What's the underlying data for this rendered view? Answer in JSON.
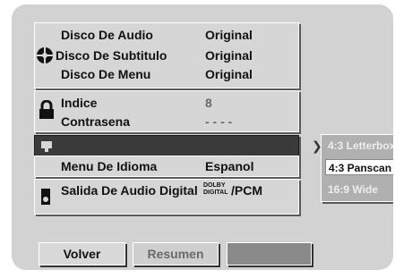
{
  "menu": {
    "disc": {
      "audio_label": "Disco De Audio",
      "audio_value": "Original",
      "subtitle_label": "Disco De Subtitulo",
      "subtitle_value": "Original",
      "menu_label": "Disco De Menu",
      "menu_value": "Original"
    },
    "lock": {
      "index_label": "Indice",
      "index_value": "8",
      "password_label": "Contrasena",
      "password_value": "- - - -"
    },
    "language": {
      "menu_label": "Menu De Idioma",
      "menu_value": "Espanol"
    },
    "audio_output": {
      "label": "Salida De Audio Digital",
      "dolby_line1": "DOLBY",
      "dolby_line2": "DIGITAL",
      "pcm": "/PCM"
    }
  },
  "submenu": {
    "options": [
      "4:3 Letterbox",
      "4:3 Panscan",
      "16:9 Wide"
    ],
    "selected": "4:3 Panscan"
  },
  "buttons": {
    "back": "Volver",
    "summary": "Resumen"
  }
}
